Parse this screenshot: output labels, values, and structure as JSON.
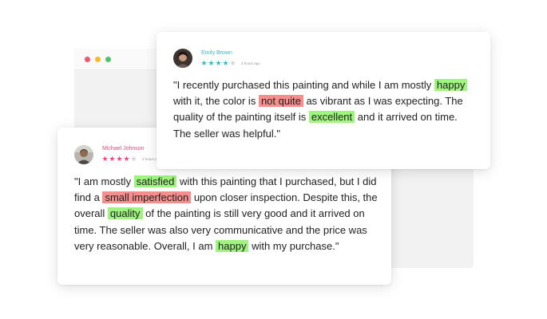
{
  "colors": {
    "positive_highlight": "#9ef47f",
    "negative_highlight": "#f78d8d",
    "emily_accent": "#3bb6c7",
    "michael_accent": "#e8497a",
    "window_dot_red": "#f0576c",
    "window_dot_yellow": "#f8bb2d",
    "window_dot_green": "#4fc26c"
  },
  "reviews": {
    "emily": {
      "name": "Emily Brown",
      "time": "3 hours ago",
      "rating": 4,
      "max_rating": 5,
      "avatar_icon": "user-avatar-photo",
      "text": {
        "t1": "\"I recently purchased this painting and while I am mostly",
        "h1": "happy",
        "t2": "with it, the color is",
        "h2": "not quite",
        "t3": "as vibrant as I was expecting. The quality of the painting itself is",
        "h3": "excellent",
        "t4": "and it arrived on time. The seller was helpful.\""
      }
    },
    "michael": {
      "name": "Michael Johnson",
      "time": "3 hours ago",
      "rating": 4,
      "max_rating": 5,
      "avatar_icon": "user-avatar-photo",
      "text": {
        "t1": "\"I am mostly",
        "h1": "satisfied",
        "t2": "with this painting that I purchased, but I did find a",
        "h2": "small imperfection",
        "t3": "upon closer inspection. Despite this, the overall",
        "h3": "quality",
        "t4": "of the painting is still very good and it arrived on time. The seller was also very communicative and the price was very reasonable. Overall, I am",
        "h4": "happy",
        "t5": "with my purchase.\""
      }
    }
  }
}
